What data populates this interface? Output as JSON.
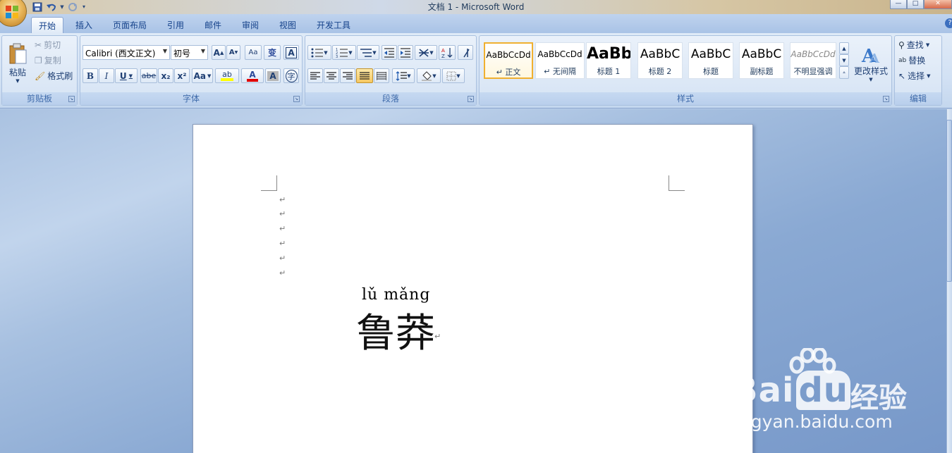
{
  "window": {
    "title": "文档 1 - Microsoft Word",
    "controls": [
      "—",
      "□",
      "✕"
    ]
  },
  "qat": {
    "icons": [
      "save-icon",
      "undo-icon",
      "redo-icon",
      "customize-icon"
    ]
  },
  "tabs": [
    {
      "label": "开始",
      "active": true
    },
    {
      "label": "插入"
    },
    {
      "label": "页面布局"
    },
    {
      "label": "引用"
    },
    {
      "label": "邮件"
    },
    {
      "label": "审阅"
    },
    {
      "label": "视图"
    },
    {
      "label": "开发工具"
    }
  ],
  "help": "?",
  "clipboard": {
    "group": "剪贴板",
    "paste": "粘贴",
    "cut": "剪切",
    "copy": "复制",
    "format_painter": "格式刷"
  },
  "font": {
    "group": "字体",
    "family": "Calibri (西文正文)",
    "size": "初号",
    "grow": "A",
    "shrink": "A",
    "clear": "Aa",
    "pinyin": "变",
    "border": "A",
    "bold": "B",
    "italic": "I",
    "underline": "U",
    "strike": "abe",
    "sub": "x₂",
    "sup": "x²",
    "case": "Aa",
    "highlight": "ab",
    "color": "A",
    "shade": "A",
    "enclose": "字"
  },
  "paragraph": {
    "group": "段落"
  },
  "styles": {
    "group": "样式",
    "items": [
      {
        "sample": "AaBbCcDd",
        "name": "↵ 正文",
        "active": true
      },
      {
        "sample": "AaBbCcDd",
        "name": "↵ 无间隔"
      },
      {
        "sample": "AaBb",
        "name": "标题 1"
      },
      {
        "sample": "AaBbC",
        "name": "标题 2"
      },
      {
        "sample": "AaBbC",
        "name": "标题"
      },
      {
        "sample": "AaBbC",
        "name": "副标题"
      },
      {
        "sample": "AaBbCcDd",
        "name": "不明显强调"
      }
    ],
    "change": "更改样式"
  },
  "editing": {
    "group": "编辑",
    "find": "查找",
    "replace": "替换",
    "select": "选择"
  },
  "document": {
    "para_mark": "↵",
    "ruby": "lǔ mǎng",
    "text": "鲁莽"
  },
  "watermark": {
    "brand": "Bai",
    "brand_du": "du",
    "jingyan": "经验",
    "url": "jingyan.baidu.com"
  },
  "colors": {
    "accent": "#15428b",
    "highlight": "#ffff00",
    "font_color": "#e00000",
    "active_style_border": "#f0b030"
  }
}
